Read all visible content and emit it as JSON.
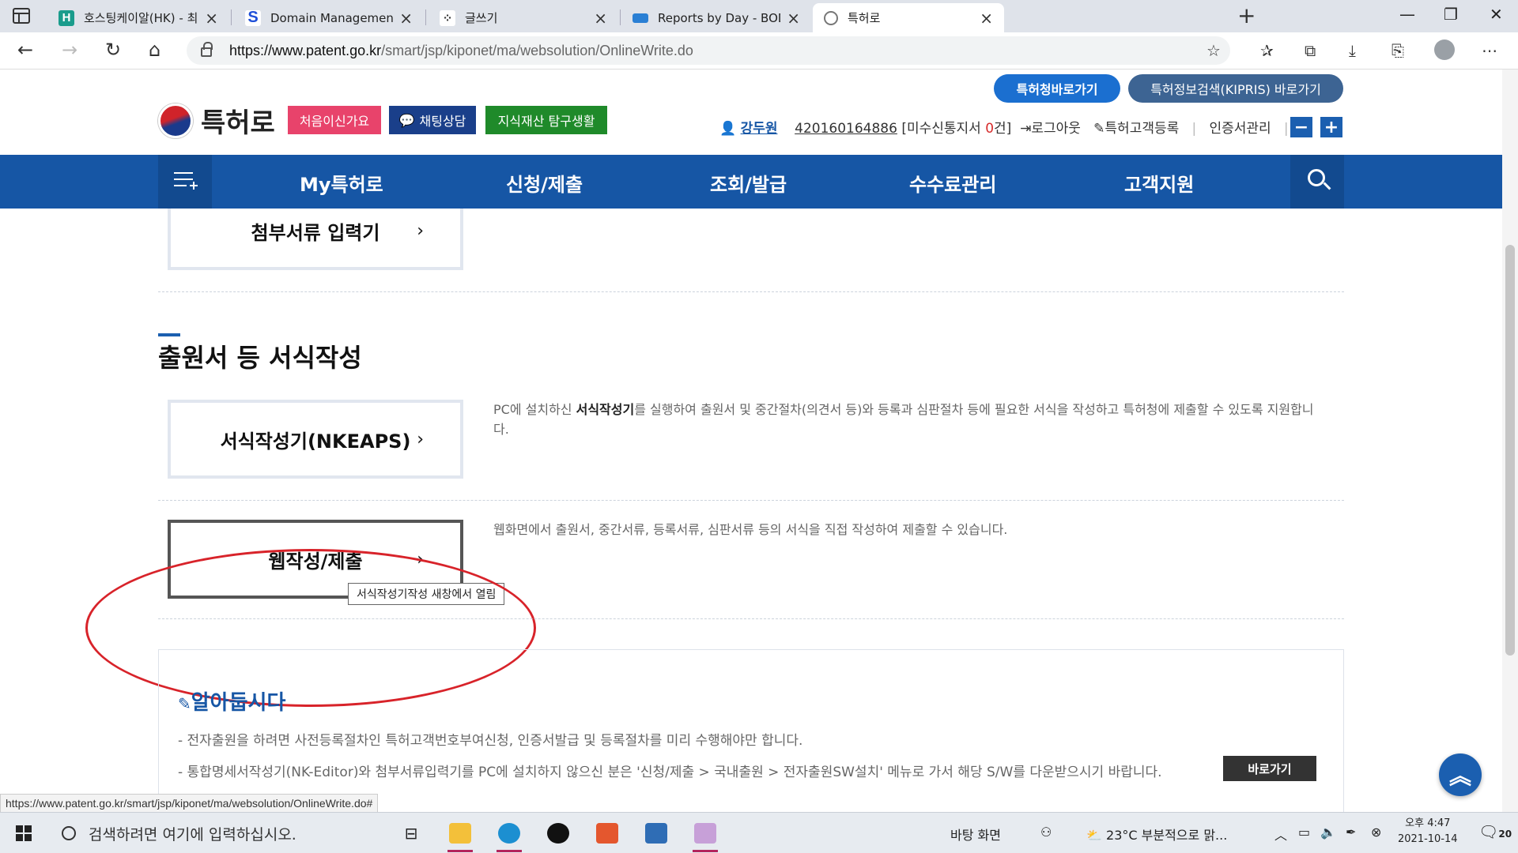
{
  "browser": {
    "tabs": [
      {
        "title": "호스팅케이알(HK) - 최저가 COM",
        "icon": "hosting-icon"
      },
      {
        "title": "Domain Management",
        "icon": "s-logo-icon"
      },
      {
        "title": "글쓰기",
        "icon": "dots-icon"
      },
      {
        "title": "Reports by Day - BODIS. Smart D",
        "icon": "bodis-icon"
      },
      {
        "title": "특허로",
        "icon": "patent-icon",
        "active": true
      }
    ],
    "url_host": "https://www.patent.go.kr",
    "url_path": "/smart/jsp/kiponet/ma/websolution/OnlineWrite.do"
  },
  "header": {
    "top_buttons": [
      "특허청바로가기",
      "특허정보검색(KIPRIS) 바로가기"
    ],
    "logo_text": "특허로",
    "badges": [
      "처음이신가요",
      "채팅상담",
      "지식재산 탐구생활"
    ],
    "user_name": "강두원",
    "user_number": "420160164886",
    "unread_prefix": "[미수신통지서 ",
    "unread_count": "0",
    "unread_suffix": "건]",
    "logout": "로그아웃",
    "register": "특허고객등록",
    "cert": "인증서관리",
    "zoom_out": "−",
    "zoom_in": "+"
  },
  "gnb": {
    "items": [
      "My특허로",
      "신청/제출",
      "조회/발급",
      "수수료관리",
      "고객지원"
    ]
  },
  "content": {
    "attach_button": "첨부서류 입력기",
    "section_title": "출원서 등 서식작성",
    "nkeaps_button": "서식작성기(NKEAPS)",
    "nkeaps_desc_1": "PC에 설치하신 ",
    "nkeaps_desc_bold": "서식작성기",
    "nkeaps_desc_2": "를 실행하여 출원서 및 중간절차(의견서 등)와 등록과 심판절차 등에 필요한 서식을 작성하고 특허청에 제출할 수 있도록 지원합니다.",
    "web_button": "웹작성/제출",
    "web_desc": "웹화면에서 출원서, 중간서류, 등록서류, 심판서류 등의 서식을 직접 작성하여 제출할 수 있습니다.",
    "tooltip": "서식작성기작성 새창에서 열림",
    "chevron": "›"
  },
  "notice": {
    "title": "알아둡시다",
    "line1": "- 전자출원을 하려면 사전등록절차인 특허고객번호부여신청, 인증서발급 및 등록절차를 미리 수행해야만 합니다.",
    "line2": "- 통합명세서작성기(NK-Editor)와 첨부서류입력기를 PC에 설치하지 않으신 분은 '신청/제출 > 국내출원 > 전자출원SW설치' 메뉴로 가서 해당 S/W를 다운받으시기 바랍니다.",
    "button": "바로가기"
  },
  "status_url": "https://www.patent.go.kr/smart/jsp/kiponet/ma/websolution/OnlineWrite.do#",
  "taskbar": {
    "search_placeholder": "검색하려면 여기에 입력하십시오.",
    "desktop_label": "바탕 화면",
    "weather": "23°C  부분적으로 맑...",
    "time": "오후 4:47",
    "date": "2021-10-14",
    "notification_count": "20"
  },
  "colors": {
    "brand_blue": "#1656a5",
    "accent_red": "#d8232a",
    "badge_pink": "#e8436b",
    "badge_navy": "#1a3f8a",
    "badge_green": "#1f8a2a"
  }
}
